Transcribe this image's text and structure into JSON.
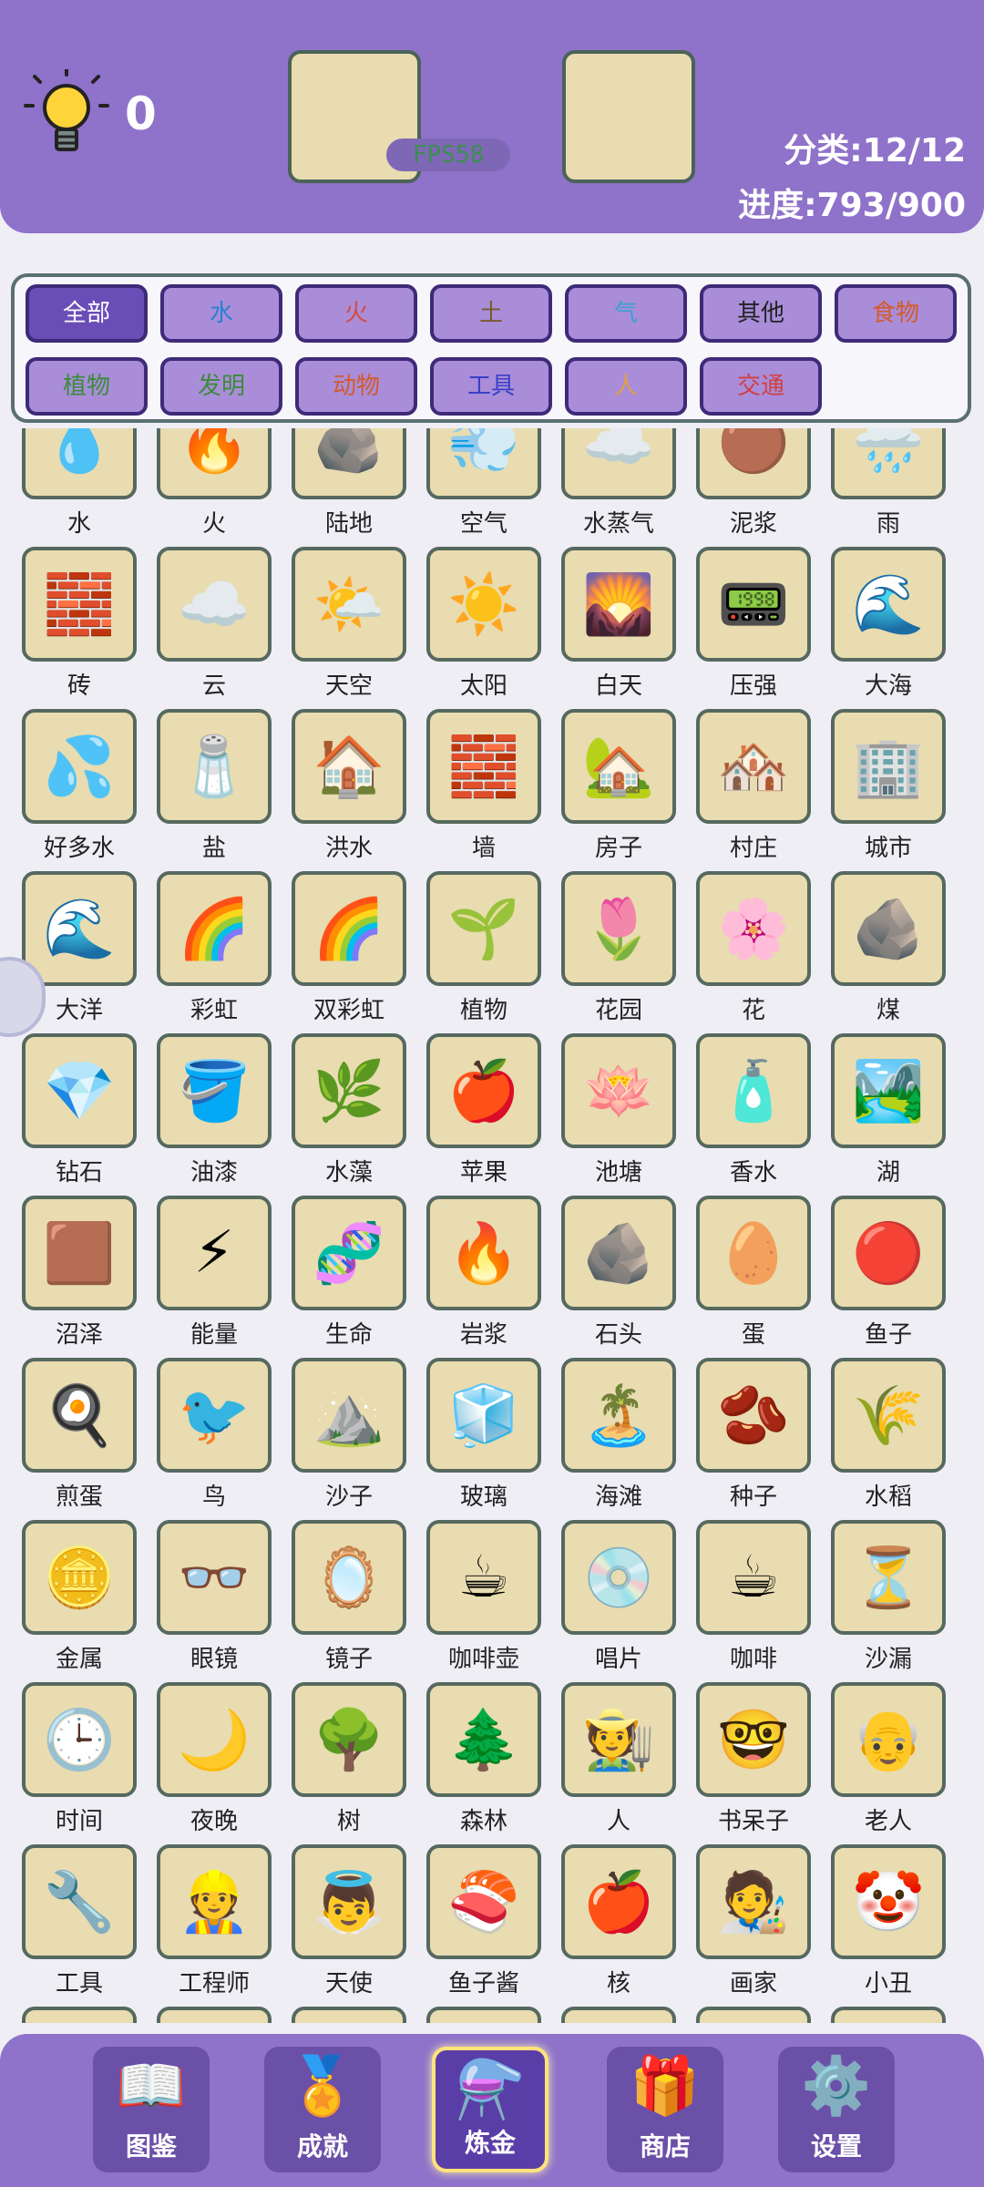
{
  "header": {
    "hint_count": "0",
    "fps": "FPS58",
    "category_label": "分类:12/12",
    "progress_label": "进度:793/900"
  },
  "tabs": [
    "全部",
    "水",
    "火",
    "土",
    "气",
    "其他",
    "食物",
    "植物",
    "发明",
    "动物",
    "工具",
    "人",
    "交通"
  ],
  "tab_colors": [
    "#ffffff",
    "#2d7fd1",
    "#d94a3a",
    "#7a5a30",
    "#3ea0d0",
    "#222222",
    "#d45a2a",
    "#3d8a3a",
    "#3d8a3a",
    "#d45a2a",
    "#3a40c8",
    "#e0a040",
    "#d04040"
  ],
  "items": [
    {
      "label": "水",
      "icon": "water-drop-icon",
      "glyph": "💧"
    },
    {
      "label": "火",
      "icon": "fire-icon",
      "glyph": "🔥"
    },
    {
      "label": "陆地",
      "icon": "land-icon",
      "glyph": "🪨"
    },
    {
      "label": "空气",
      "icon": "wind-icon",
      "glyph": "💨"
    },
    {
      "label": "水蒸气",
      "icon": "steam-icon",
      "glyph": "☁️"
    },
    {
      "label": "泥浆",
      "icon": "mud-icon",
      "glyph": "🟤"
    },
    {
      "label": "雨",
      "icon": "rain-icon",
      "glyph": "🌧️"
    },
    {
      "label": "砖",
      "icon": "brick-icon",
      "glyph": "🧱"
    },
    {
      "label": "云",
      "icon": "cloud-icon",
      "glyph": "☁️"
    },
    {
      "label": "天空",
      "icon": "sky-icon",
      "glyph": "🌤️"
    },
    {
      "label": "太阳",
      "icon": "sun-icon",
      "glyph": "☀️"
    },
    {
      "label": "白天",
      "icon": "day-icon",
      "glyph": "🌄"
    },
    {
      "label": "压强",
      "icon": "pressure-icon",
      "glyph": "📟"
    },
    {
      "label": "大海",
      "icon": "sea-icon",
      "glyph": "🌊"
    },
    {
      "label": "好多水",
      "icon": "puddle-icon",
      "glyph": "💦"
    },
    {
      "label": "盐",
      "icon": "salt-icon",
      "glyph": "🧂"
    },
    {
      "label": "洪水",
      "icon": "flood-icon",
      "glyph": "🏠"
    },
    {
      "label": "墙",
      "icon": "wall-icon",
      "glyph": "🧱"
    },
    {
      "label": "房子",
      "icon": "house-icon",
      "glyph": "🏡"
    },
    {
      "label": "村庄",
      "icon": "village-icon",
      "glyph": "🏘️"
    },
    {
      "label": "城市",
      "icon": "city-icon",
      "glyph": "🏢"
    },
    {
      "label": "大洋",
      "icon": "ocean-icon",
      "glyph": "🌊"
    },
    {
      "label": "彩虹",
      "icon": "rainbow-icon",
      "glyph": "🌈"
    },
    {
      "label": "双彩虹",
      "icon": "double-rainbow-icon",
      "glyph": "🌈"
    },
    {
      "label": "植物",
      "icon": "plant-icon",
      "glyph": "🌱"
    },
    {
      "label": "花园",
      "icon": "garden-icon",
      "glyph": "🌷"
    },
    {
      "label": "花",
      "icon": "flower-icon",
      "glyph": "🌸"
    },
    {
      "label": "煤",
      "icon": "coal-icon",
      "glyph": "🪨"
    },
    {
      "label": "钻石",
      "icon": "diamond-icon",
      "glyph": "💎"
    },
    {
      "label": "油漆",
      "icon": "paint-icon",
      "glyph": "🪣"
    },
    {
      "label": "水藻",
      "icon": "algae-icon",
      "glyph": "🌿"
    },
    {
      "label": "苹果",
      "icon": "apple-icon",
      "glyph": "🍎"
    },
    {
      "label": "池塘",
      "icon": "pond-icon",
      "glyph": "🪷"
    },
    {
      "label": "香水",
      "icon": "perfume-icon",
      "glyph": "🧴"
    },
    {
      "label": "湖",
      "icon": "lake-icon",
      "glyph": "🏞️"
    },
    {
      "label": "沼泽",
      "icon": "swamp-icon",
      "glyph": "🟫"
    },
    {
      "label": "能量",
      "icon": "energy-icon",
      "glyph": "⚡"
    },
    {
      "label": "生命",
      "icon": "dna-icon",
      "glyph": "🧬"
    },
    {
      "label": "岩浆",
      "icon": "lava-icon",
      "glyph": "🔥"
    },
    {
      "label": "石头",
      "icon": "stone-icon",
      "glyph": "🪨"
    },
    {
      "label": "蛋",
      "icon": "egg-icon",
      "glyph": "🥚"
    },
    {
      "label": "鱼子",
      "icon": "roe-icon",
      "glyph": "🔴"
    },
    {
      "label": "煎蛋",
      "icon": "fried-egg-icon",
      "glyph": "🍳"
    },
    {
      "label": "鸟",
      "icon": "bird-icon",
      "glyph": "🐦"
    },
    {
      "label": "沙子",
      "icon": "sand-icon",
      "glyph": "⛰️"
    },
    {
      "label": "玻璃",
      "icon": "glass-icon",
      "glyph": "🧊"
    },
    {
      "label": "海滩",
      "icon": "beach-icon",
      "glyph": "🏝️"
    },
    {
      "label": "种子",
      "icon": "seed-icon",
      "glyph": "🫘"
    },
    {
      "label": "水稻",
      "icon": "rice-icon",
      "glyph": "🌾"
    },
    {
      "label": "金属",
      "icon": "metal-icon",
      "glyph": "🪙"
    },
    {
      "label": "眼镜",
      "icon": "glasses-icon",
      "glyph": "👓"
    },
    {
      "label": "镜子",
      "icon": "mirror-icon",
      "glyph": "🪞"
    },
    {
      "label": "咖啡壶",
      "icon": "coffee-pot-icon",
      "glyph": "☕"
    },
    {
      "label": "唱片",
      "icon": "record-icon",
      "glyph": "💿"
    },
    {
      "label": "咖啡",
      "icon": "coffee-icon",
      "glyph": "☕"
    },
    {
      "label": "沙漏",
      "icon": "hourglass-icon",
      "glyph": "⏳"
    },
    {
      "label": "时间",
      "icon": "clock-icon",
      "glyph": "🕒"
    },
    {
      "label": "夜晚",
      "icon": "night-icon",
      "glyph": "🌙"
    },
    {
      "label": "树",
      "icon": "tree-icon",
      "glyph": "🌳"
    },
    {
      "label": "森林",
      "icon": "forest-icon",
      "glyph": "🌲"
    },
    {
      "label": "人",
      "icon": "person-icon",
      "glyph": "🧑‍🌾"
    },
    {
      "label": "书呆子",
      "icon": "nerd-icon",
      "glyph": "🤓"
    },
    {
      "label": "老人",
      "icon": "old-man-icon",
      "glyph": "👴"
    },
    {
      "label": "工具",
      "icon": "tools-icon",
      "glyph": "🔧"
    },
    {
      "label": "工程师",
      "icon": "engineer-icon",
      "glyph": "👷"
    },
    {
      "label": "天使",
      "icon": "angel-icon",
      "glyph": "👼"
    },
    {
      "label": "鱼子酱",
      "icon": "caviar-icon",
      "glyph": "🍣"
    },
    {
      "label": "核",
      "icon": "apple-core-icon",
      "glyph": "🍎"
    },
    {
      "label": "画家",
      "icon": "painter-icon",
      "glyph": "🧑‍🎨"
    },
    {
      "label": "小丑",
      "icon": "clown-icon",
      "glyph": "🤡"
    }
  ],
  "bottom_nav": [
    {
      "label": "图鉴",
      "icon": "book-icon",
      "glyph": "📖"
    },
    {
      "label": "成就",
      "icon": "medal-icon",
      "glyph": "🏅"
    },
    {
      "label": "炼金",
      "icon": "flask-icon",
      "glyph": "⚗️"
    },
    {
      "label": "商店",
      "icon": "gift-icon",
      "glyph": "🎁"
    },
    {
      "label": "设置",
      "icon": "gear-icon",
      "glyph": "⚙️"
    }
  ],
  "active_nav": 2
}
